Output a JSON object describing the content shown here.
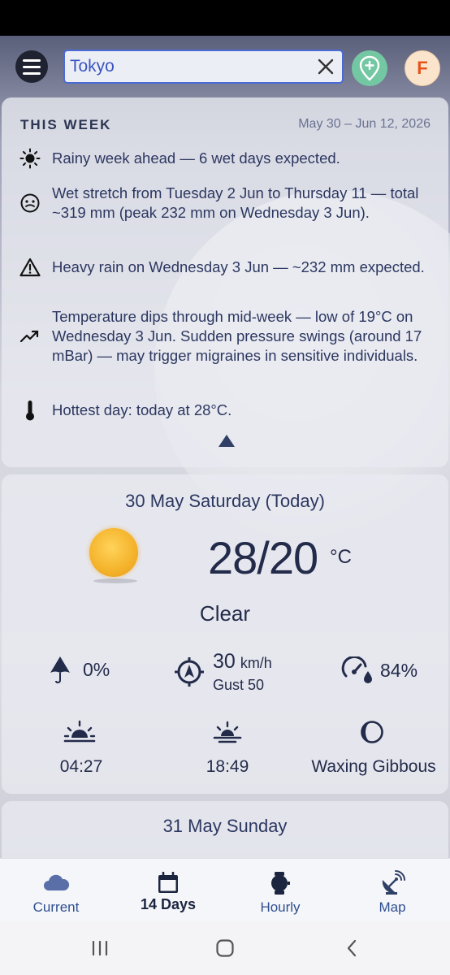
{
  "search": {
    "value": "Tokyo"
  },
  "profile": {
    "initial": "F"
  },
  "week": {
    "heading": "THIS WEEK",
    "range": "May 30 – Jun 12, 2026",
    "insights": [
      {
        "icon": "sun-icon",
        "text": "Rainy week ahead — 6 wet days expected."
      },
      {
        "icon": "umbrella-face-icon",
        "text": "Wet stretch from Tuesday 2 Jun to Thursday 11 — total ~319 mm (peak 232 mm on Wednesday 3 Jun)."
      },
      {
        "icon": "warning-icon",
        "text": "Heavy rain on Wednesday 3 Jun — ~232 mm expected."
      },
      {
        "icon": "trend-icon",
        "text": "Temperature dips through mid-week — low of 19°C on Wednesday 3 Jun. Sudden pressure swings (around 17 mBar) — may trigger migraines in sensitive individuals."
      },
      {
        "icon": "thermometer-icon",
        "text": "Hottest day: today at 28°C."
      }
    ]
  },
  "today": {
    "title": "30 May Saturday (Today)",
    "temp": "28/20",
    "unit": "°C",
    "condition": "Clear",
    "precip": "0%",
    "wind": "30",
    "wind_unit": "km/h",
    "gust": "Gust 50",
    "humidity": "84%",
    "sunrise": "04:27",
    "sunset": "18:49",
    "moon": "Waxing Gibbous"
  },
  "next": {
    "title": "31 May Sunday"
  },
  "nav": {
    "current": "Current",
    "days": "14 Days",
    "hourly": "Hourly",
    "map": "Map"
  },
  "colors": {
    "accent": "#4a6bd6",
    "location": "#74c7a3",
    "profile": "#e2561c"
  }
}
